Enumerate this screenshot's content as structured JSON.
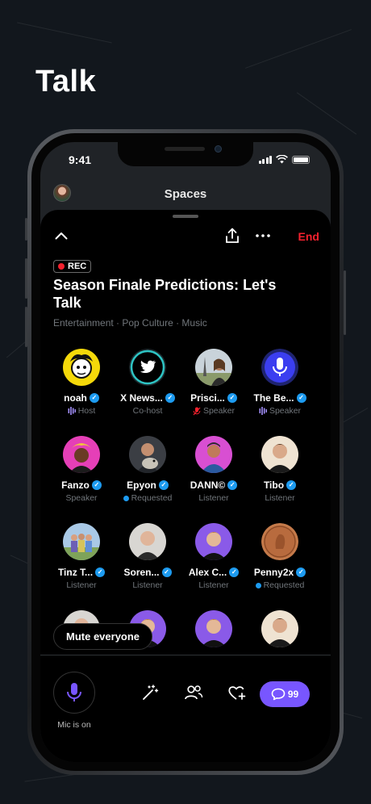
{
  "headline": "Talk",
  "status": {
    "time": "9:41"
  },
  "topbar": {
    "title": "Spaces"
  },
  "space": {
    "rec_label": "REC",
    "end_label": "End",
    "title": "Season Finale Predictions: Let's Talk",
    "topics": "Entertainment · Pop Culture · Music"
  },
  "participants": [
    {
      "name": "noah",
      "role": "Host",
      "role_icon": "speaking-bars-icon",
      "avatar": "cartoon-yellow"
    },
    {
      "name": "X News...",
      "role": "Co-host",
      "role_icon": "",
      "avatar": "twitter-bird"
    },
    {
      "name": "Prisci...",
      "role": "Speaker",
      "role_icon": "mic-muted-icon",
      "avatar": "photo-eiffel"
    },
    {
      "name": "The Be...",
      "role": "Speaker",
      "role_icon": "speaking-bars-icon",
      "avatar": "mic-purple"
    },
    {
      "name": "Fanzo",
      "role": "Speaker",
      "role_icon": "",
      "avatar": "photo-pink"
    },
    {
      "name": "Epyon",
      "role": "Requested",
      "role_icon": "blue-dot",
      "avatar": "photo-dog"
    },
    {
      "name": "DANN©",
      "role": "Listener",
      "role_icon": "",
      "avatar": "photo-pink-bg"
    },
    {
      "name": "Tibo",
      "role": "Listener",
      "role_icon": "",
      "avatar": "photo-man-beige"
    },
    {
      "name": "Tinz T...",
      "role": "Listener",
      "role_icon": "",
      "avatar": "photo-group"
    },
    {
      "name": "Soren...",
      "role": "Listener",
      "role_icon": "",
      "avatar": "photo-man-grey"
    },
    {
      "name": "Alex C...",
      "role": "Listener",
      "role_icon": "",
      "avatar": "photo-purple"
    },
    {
      "name": "Penny2x",
      "role": "Requested",
      "role_icon": "blue-dot",
      "avatar": "penny-coin"
    }
  ],
  "controls": {
    "mute_everyone": "Mute everyone",
    "mic_caption": "Mic is on",
    "chat_count": "99"
  },
  "colors": {
    "accent": "#1d9bf0",
    "end": "#f4212e",
    "chat": "#7856ff",
    "mic": "#7856ff"
  }
}
